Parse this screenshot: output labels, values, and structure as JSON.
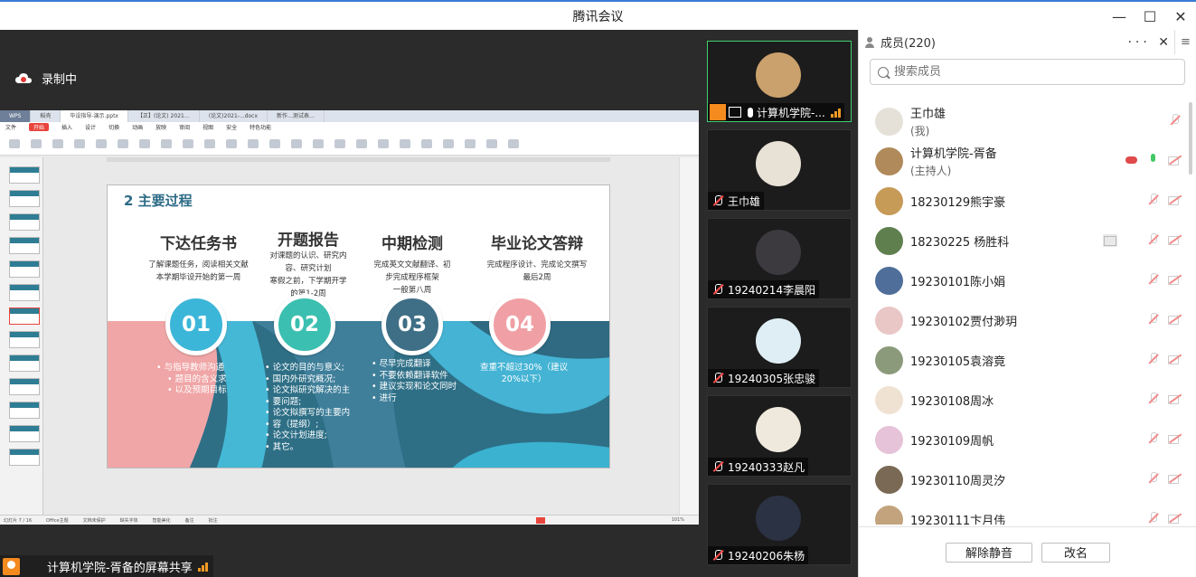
{
  "window": {
    "title": "腾讯会议",
    "minimize": "—",
    "maximize": "☐",
    "close": "✕"
  },
  "recording": {
    "label": "录制中"
  },
  "share": {
    "label": "计算机学院-胥备的屏幕共享"
  },
  "wps": {
    "tabs": [
      "WPS",
      "稻壳",
      "毕设指导-演示.pptx",
      "【正】(论文) 2021…",
      "(论文)2021-...docx",
      "新作…测试表…"
    ],
    "menu": [
      "文件",
      "开始",
      "插入",
      "设计",
      "切换",
      "动画",
      "放映",
      "审阅",
      "视图",
      "安全",
      "特色功能"
    ],
    "active_menu": "开始",
    "status": [
      "幻灯片 7 / 16",
      "Office主题",
      "文档未保护",
      "缺失字体",
      "智能美化",
      "备注",
      "批注",
      "101%"
    ]
  },
  "slide": {
    "title": "2 主要过程",
    "steps": [
      {
        "num": "01",
        "head": "下达任务书",
        "desc": [
          "了解课题任务，阅读相关文献",
          "本学期毕设开始的第一周"
        ],
        "bullets": [
          "与指导教师沟通",
          "题目的含义求",
          "以及预期目标"
        ]
      },
      {
        "num": "02",
        "head": "开题报告",
        "desc": [
          "对课题的认识、研究内",
          "容、研究计划",
          "寒假之前，下学期开学",
          "的第1-2周"
        ],
        "bullets": [
          "论文的目的与意义;",
          "国内外研究概况;",
          "论文拟研究解决的主",
          "要问题;",
          "论文拟撰写的主要内",
          "容（提纲）;",
          "论文计划进度;",
          "其它。"
        ]
      },
      {
        "num": "03",
        "head": "中期检测",
        "desc": [
          "完成英文文献翻译、初",
          "步完成程序框架",
          "一般第八周"
        ],
        "bullets": [
          "尽早完成翻译",
          "不要依赖翻译软件",
          "建议实现和论文同时",
          "进行"
        ]
      },
      {
        "num": "04",
        "head": "毕业论文答辩",
        "desc": [
          "完成程序设计、完成论文撰写",
          "最后2周"
        ],
        "bullets": [
          "查重不超过30%（建议",
          "20%以下）"
        ]
      }
    ],
    "colors": {
      "c1": "#3cb6d8",
      "c2": "#3bbfb0",
      "c3": "#3f6f86",
      "c4": "#f0a0a5"
    }
  },
  "videos": [
    {
      "name": "计算机学院-...",
      "host": true
    },
    {
      "name": "王巾雄"
    },
    {
      "name": "19240214李晨阳"
    },
    {
      "name": "19240305张忠骏"
    },
    {
      "name": "19240333赵凡"
    },
    {
      "name": "19240206朱杨"
    }
  ],
  "members_panel": {
    "title": "成员(220)",
    "more": "···",
    "close": "✕",
    "menu": "≡",
    "search_placeholder": "搜索成员",
    "members": [
      {
        "name": "王巾雄",
        "sub": "(我)",
        "color": "#e6e1d8"
      },
      {
        "name": "计算机学院-胥备",
        "sub": "(主持人)",
        "color": "#b08a5a"
      },
      {
        "name": "18230129熊宇豪",
        "color": "#c69a57"
      },
      {
        "name": "18230225 杨胜科",
        "color": "#5f7f4f"
      },
      {
        "name": "19230101陈小娟",
        "color": "#4f6f9a"
      },
      {
        "name": "19230102贾付渺玥",
        "color": "#e9c7c6"
      },
      {
        "name": "19230105袁溶竟",
        "color": "#8c9a7c"
      },
      {
        "name": "19230108周冰",
        "color": "#f0e2d3"
      },
      {
        "name": "19230109周帆",
        "color": "#e6c3d8"
      },
      {
        "name": "19230110周灵汐",
        "color": "#7a6a55"
      },
      {
        "name": "19230111卞月伟",
        "color": "#c2a37d"
      }
    ],
    "unmute_label": "解除静音",
    "rename_label": "改名"
  }
}
